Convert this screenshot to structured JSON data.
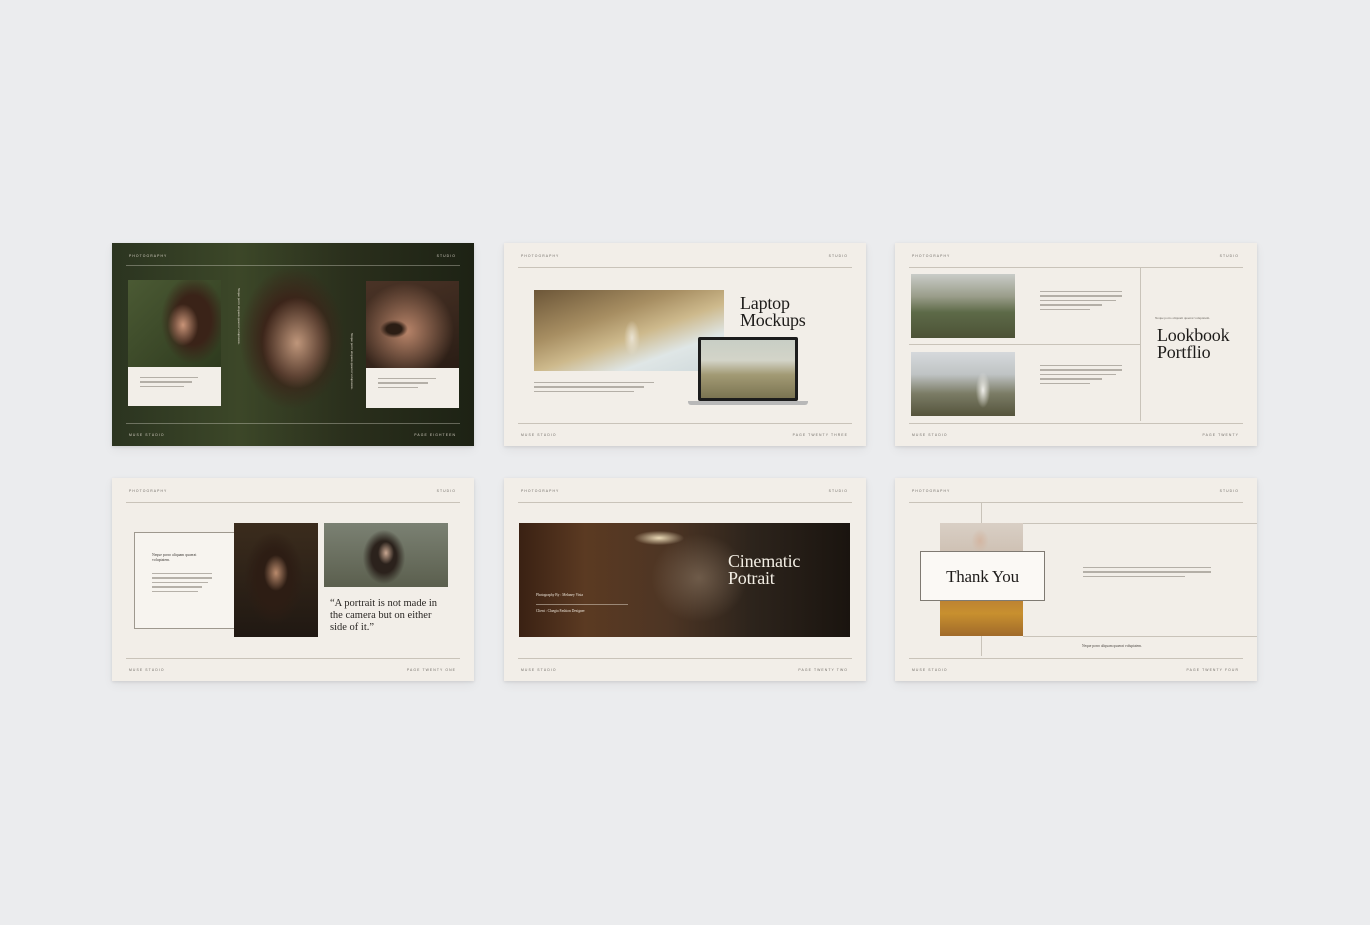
{
  "slides": [
    {
      "header_left": "PHOTOGRAPHY",
      "header_right": "STUDIO",
      "footer_left": "MUSE STUDIO",
      "footer_right": "PAGE EIGHTEEN",
      "vertical_caption": "Neque porro aliquam quaerat voluptatem."
    },
    {
      "header_left": "PHOTOGRAPHY",
      "header_right": "STUDIO",
      "footer_left": "MUSE STUDIO",
      "footer_right": "PAGE TWENTY THREE",
      "title_line1": "Laptop",
      "title_line2": "Mockups"
    },
    {
      "header_left": "PHOTOGRAPHY",
      "header_right": "STUDIO",
      "footer_left": "MUSE STUDIO",
      "footer_right": "PAGE TWENTY",
      "tagline": "Neque porro aliquam quaerat voluptatem.",
      "title_line1": "Lookbook",
      "title_line2": "Portflio"
    },
    {
      "header_left": "PHOTOGRAPHY",
      "header_right": "STUDIO",
      "footer_left": "MUSE STUDIO",
      "footer_right": "PAGE TWENTY ONE",
      "card_heading": "Neque porro aliquam quaerat voluptatem.",
      "quote": "“A portrait is not made in the camera but on either side of it.”"
    },
    {
      "header_left": "PHOTOGRAPHY",
      "header_right": "STUDIO",
      "footer_left": "MUSE STUDIO",
      "footer_right": "PAGE TWENTY TWO",
      "title_line1": "Cinematic",
      "title_line2": "Potrait",
      "credit_photographer": "Photography By : Melaney Vista",
      "credit_client": "Client : Claegia Fashion Designer"
    },
    {
      "header_left": "PHOTOGRAPHY",
      "header_right": "STUDIO",
      "footer_left": "MUSE STUDIO",
      "footer_right": "PAGE TWENTY FOUR",
      "title": "Thank You",
      "caption": "Neque porro aliquam quaerat voluptatem."
    }
  ]
}
